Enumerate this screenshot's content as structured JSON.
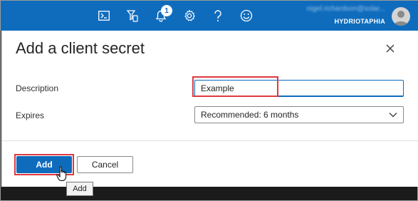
{
  "topbar": {
    "icons": [
      "cloud-shell-icon",
      "directory-filter-icon",
      "notifications-icon",
      "settings-icon",
      "help-icon",
      "feedback-icon"
    ],
    "notification_count": "1",
    "account_email": "nigel.richardson@solar...",
    "account_directory": "HYDRIOTAPHIA",
    "brand_color": "#0f6cbd"
  },
  "dialog": {
    "title": "Add a client secret",
    "fields": {
      "description_label": "Description",
      "description_value": "Example",
      "expires_label": "Expires",
      "expires_value": "Recommended: 6 months"
    },
    "buttons": {
      "add_label": "Add",
      "cancel_label": "Cancel"
    },
    "tooltip": "Add",
    "highlight_color": "#e0393e"
  }
}
